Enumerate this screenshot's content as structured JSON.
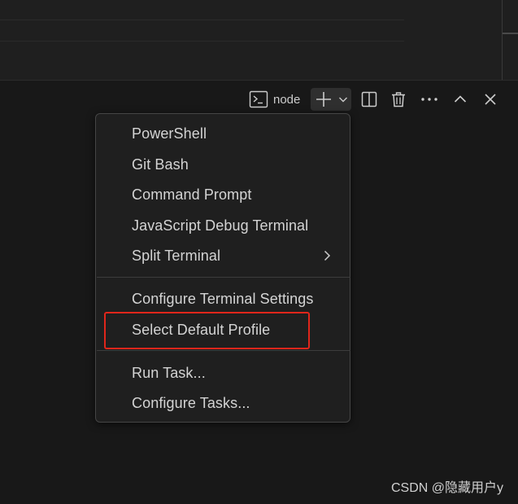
{
  "toolbar": {
    "terminal_name": "node",
    "terminal_icon": "terminal-icon",
    "new_terminal_icon": "plus-icon",
    "profiles_dropdown_icon": "chevron-down-icon",
    "split_icon": "split-terminal-icon",
    "kill_icon": "trash-icon",
    "more_icon": "ellipsis-icon",
    "maximize_icon": "chevron-up-icon",
    "close_icon": "close-icon"
  },
  "menu": {
    "groups": [
      {
        "items": [
          {
            "label": "PowerShell"
          },
          {
            "label": "Git Bash"
          },
          {
            "label": "Command Prompt"
          },
          {
            "label": "JavaScript Debug Terminal"
          },
          {
            "label": "Split Terminal",
            "submenu": true
          }
        ]
      },
      {
        "items": [
          {
            "label": "Configure Terminal Settings"
          },
          {
            "label": "Select Default Profile",
            "highlighted": true
          }
        ]
      },
      {
        "items": [
          {
            "label": "Run Task..."
          },
          {
            "label": "Configure Tasks..."
          }
        ]
      }
    ]
  },
  "watermark": "CSDN @隐藏用户y",
  "colors": {
    "highlight_border": "#e0261b",
    "panel_bg": "#181818",
    "menu_bg": "#1f1f1f"
  }
}
